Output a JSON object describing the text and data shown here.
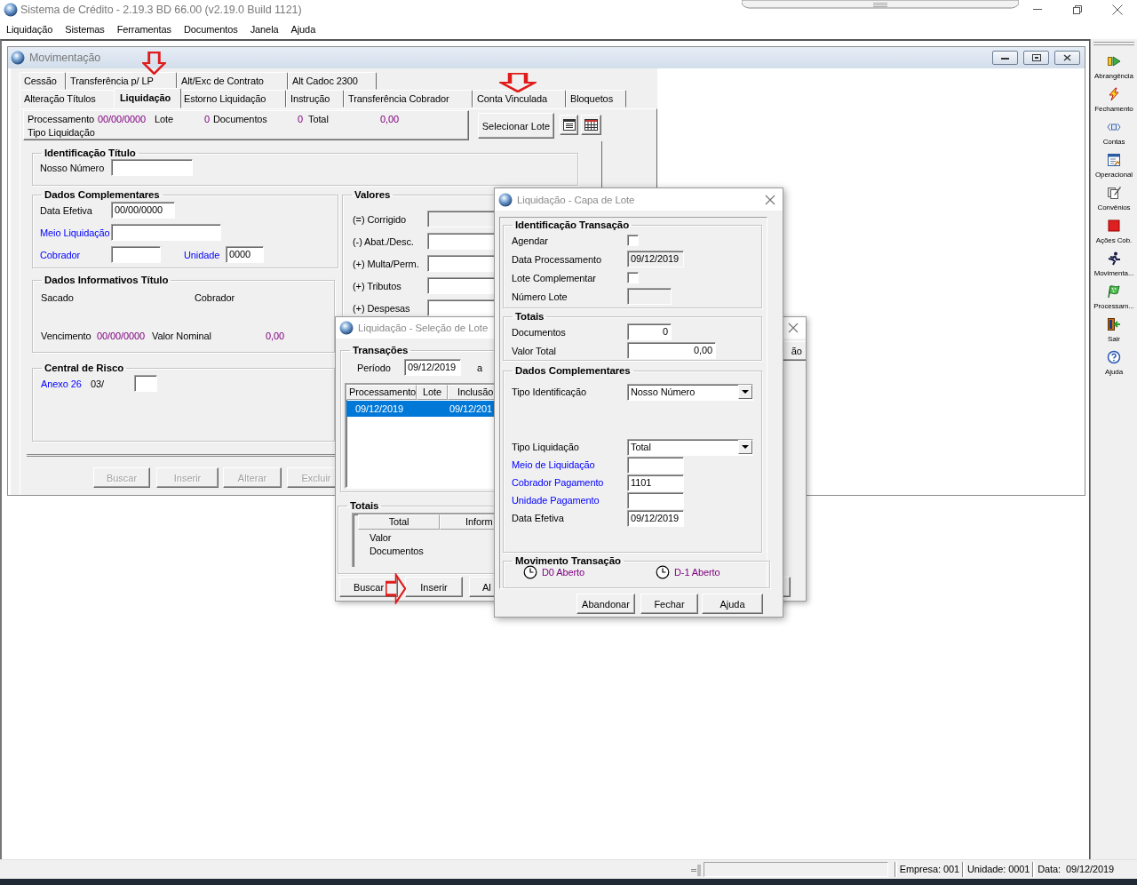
{
  "app": {
    "title": "Sistema de Crédito - 2.19.3 BD 66.00 (v2.19.0 Build 1121)"
  },
  "menu": [
    "Liquidação",
    "Sistemas",
    "Ferramentas",
    "Documentos",
    "Janela",
    "Ajuda"
  ],
  "movimentacao": {
    "title": "Movimentação",
    "tabs_row_1": [
      {
        "label": "Cessão",
        "selected": false
      },
      {
        "label": "Transferência p/ LP",
        "selected": false
      },
      {
        "label": "Alt/Exc de Contrato",
        "selected": false
      },
      {
        "label": "Alt Cadoc 2300",
        "selected": false
      }
    ],
    "tabs_row_2": [
      {
        "label": "Alteração Títulos",
        "selected": false
      },
      {
        "label": "Liquidação",
        "selected": true
      },
      {
        "label": "Estorno Liquidação",
        "selected": false
      },
      {
        "label": "Instrução",
        "selected": false
      },
      {
        "label": "Transferência Cobrador",
        "selected": false
      },
      {
        "label": "Conta Vinculada",
        "selected": false
      },
      {
        "label": "Bloquetos",
        "selected": false
      }
    ],
    "summary": [
      {
        "label": "Processamento",
        "value": "00/00/0000"
      },
      {
        "label": "Lote",
        "value": "0"
      },
      {
        "label": "Documentos",
        "value": "0"
      },
      {
        "label": "Total",
        "value": "0,00"
      }
    ],
    "summary_caption": "Tipo Liquidação",
    "select_button": "Selecionar Lote",
    "identificacao": {
      "title": "Identificação Título",
      "fields": [
        {
          "label": "Nosso Número"
        }
      ]
    },
    "dados_complementares": {
      "title": "Dados Complementares",
      "rows": [
        [
          {
            "label": "Data Efetiva",
            "kind": "text",
            "value": "00/00/0000"
          }
        ],
        [
          {
            "label": "Meio Liquidação",
            "kind": "link"
          }
        ],
        [
          {
            "label": "Cobrador",
            "kind": "link"
          },
          {
            "label": "Unidade",
            "kind": "link",
            "value": "0000"
          }
        ]
      ]
    },
    "valores": {
      "title": "Valores",
      "fields": [
        {
          "label": "(=) Corrigido",
          "disabled": true
        },
        {
          "label": "(-) Abat./Desc.",
          "disabled": false
        },
        {
          "label": "(+) Multa/Perm.",
          "disabled": false
        },
        {
          "label": "(+) Tributos",
          "disabled": false
        },
        {
          "label": "(+) Despesas",
          "disabled": false
        }
      ]
    },
    "dados_informativos": {
      "title": "Dados Informativos Título",
      "labels": [
        "Sacado",
        "Cobrador"
      ],
      "vencimento": {
        "label": "Vencimento",
        "value": "00/00/0000"
      },
      "valor_nominal": {
        "label": "Valor Nominal",
        "value": "0,00"
      }
    },
    "central_risco": {
      "title": "Central de Risco",
      "link": "Anexo 26",
      "text": "03/"
    },
    "buttons": [
      {
        "label": "Buscar",
        "disabled": true
      },
      {
        "label": "Inserir",
        "disabled": true
      },
      {
        "label": "Alterar",
        "disabled": true
      },
      {
        "label": "Excluir",
        "disabled": true
      }
    ]
  },
  "selecao": {
    "title": "Liquidação - Seleção de Lote",
    "transacoes": {
      "title": "Transações",
      "periodo_label": "Período",
      "periodo_value": "09/12/2019",
      "to_label": "a",
      "columns": [
        "Processamento",
        "Lote",
        "Inclusão"
      ],
      "rows": [
        {
          "cells": [
            "09/12/2019",
            "",
            "09/12/201"
          ],
          "selected": true
        }
      ]
    },
    "side_button": "ão",
    "totais": {
      "title": "Totais",
      "columns": [
        "Total",
        "Inform"
      ],
      "rows": [
        "Valor",
        "Documentos"
      ]
    },
    "buttons": [
      {
        "label": "Buscar"
      },
      {
        "label": "Inserir"
      },
      {
        "label": "Al"
      }
    ]
  },
  "capa": {
    "title": "Liquidação - Capa de Lote",
    "identificacao": {
      "title": "Identificação Transação",
      "fields": [
        {
          "label": "Agendar",
          "kind": "checkbox",
          "checked": false
        },
        {
          "label": "Data Processamento",
          "kind": "text",
          "value": "09/12/2019",
          "disabled": true
        },
        {
          "label": "Lote Complementar",
          "kind": "checkbox",
          "checked": false
        },
        {
          "label": "Número Lote",
          "kind": "text",
          "disabled": true
        }
      ]
    },
    "totais": {
      "title": "Totais",
      "fields": [
        {
          "label": "Documentos",
          "kind": "number",
          "value": "0"
        },
        {
          "label": "Valor Total",
          "kind": "number",
          "value": "0,00"
        }
      ]
    },
    "dados_complementares": {
      "title": "Dados Complementares",
      "fields": [
        {
          "label": "Tipo Identificação",
          "kind": "select",
          "value": "Nosso Número"
        },
        {
          "label": "Tipo Liquidação",
          "kind": "select",
          "value": "Total"
        },
        {
          "label": "Meio de Liquidação",
          "kind": "link"
        },
        {
          "label": "Cobrador Pagamento",
          "kind": "link",
          "value": "1101"
        },
        {
          "label": "Unidade Pagamento",
          "kind": "link"
        },
        {
          "label": "Data Efetiva",
          "kind": "text",
          "value": "09/12/2019"
        }
      ]
    },
    "movimento": {
      "title": "Movimento Transação",
      "items": [
        "D0 Aberto",
        "D-1 Aberto"
      ]
    },
    "buttons": [
      "Abandonar",
      "Fechar",
      "Ajuda"
    ]
  },
  "sidebar": [
    "Abrangência",
    "Fechamento",
    "Contas",
    "Operacional",
    "Convênios",
    "Ações Cob.",
    "Movimenta...",
    "Processam...",
    "Sair",
    "Ajuda"
  ],
  "status_bar": [
    "Empresa: 001",
    "Unidade: 0001",
    "Data:  09/12/2019"
  ],
  "annotations": [
    {
      "kind": "down_arrow"
    },
    {
      "kind": "down_arrow"
    },
    {
      "kind": "right_arrow"
    }
  ]
}
